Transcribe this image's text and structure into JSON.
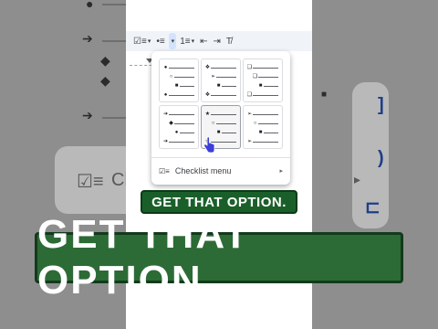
{
  "toolbar": {
    "buttons": [
      {
        "name": "checklist",
        "glyph": "☑≡"
      },
      {
        "name": "bulleted-list",
        "glyph": "•≡"
      },
      {
        "name": "numbered-list",
        "glyph": "1≡"
      },
      {
        "name": "decrease-indent",
        "glyph": "⇤"
      },
      {
        "name": "increase-indent",
        "glyph": "⇥"
      },
      {
        "name": "clear-formatting",
        "glyph": "T̸"
      }
    ]
  },
  "menu": {
    "options": [
      {
        "id": "disc-circle-square",
        "glyphs": [
          "●",
          "○",
          "■",
          "●"
        ]
      },
      {
        "id": "diamond-arrow-square",
        "glyphs": [
          "❖",
          "➢",
          "■",
          "❖"
        ]
      },
      {
        "id": "square-square-square",
        "glyphs": [
          "❑",
          "❑",
          "■",
          "❑"
        ]
      },
      {
        "id": "arrow-diamond-disc",
        "glyphs": [
          "➔",
          "◆",
          "●",
          "➔"
        ]
      },
      {
        "id": "star-circle-square",
        "glyphs": [
          "★",
          "○",
          "■",
          "★"
        ]
      },
      {
        "id": "arrowhead-circle-square",
        "glyphs": [
          "➢",
          "○",
          "■",
          "➢"
        ]
      }
    ],
    "checklist_label": "Checklist menu",
    "checklist_icon": "☑≡",
    "submenu_arrow": "▸"
  },
  "captions": {
    "small": "GET THAT OPTION.",
    "big": "GET THAT OPTION."
  },
  "background": {
    "left_text": "Ch",
    "left_icon": "☑≡"
  },
  "colors": {
    "caption_green": "#2c6b36",
    "accent_blue": "#1e3f86",
    "toolbar_bg": "#f0f4f9"
  }
}
